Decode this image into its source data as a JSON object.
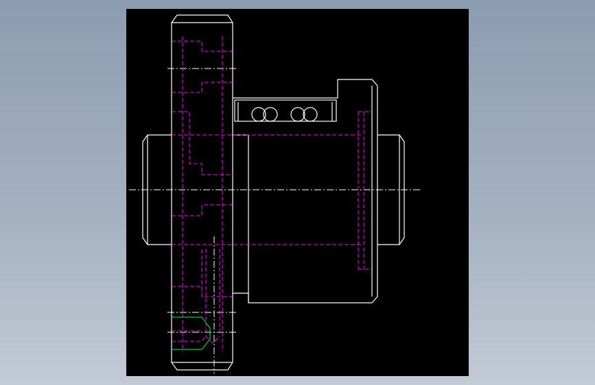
{
  "viewport": {
    "background": "#000000",
    "colors": {
      "visible_edge": "#ffffff",
      "hidden_line": "#ff00ff",
      "center_line": "#ffffff",
      "highlight": "#00cc33"
    },
    "views": [
      "side-section"
    ]
  }
}
